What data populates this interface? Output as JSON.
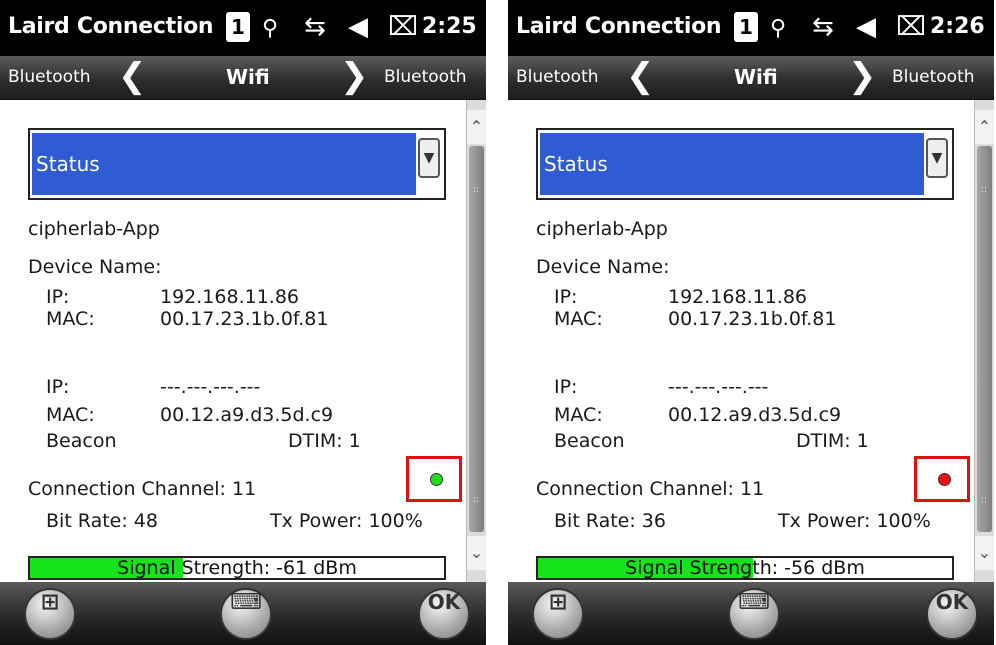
{
  "screens": [
    {
      "app_title": "Laird Connection",
      "sim_label": "1",
      "time": "2:25",
      "nav": {
        "prev_label": "Bluetooth",
        "current": "Wifi",
        "next_label": "Bluetooth",
        "prev_arrow": "❮",
        "next_arrow": "❯"
      },
      "dropdown_selected": "Status",
      "ssid": "cipherlab-App",
      "device_name_label": "Device Name:",
      "ip_label": "IP:",
      "mac_label": "MAC:",
      "ip1": "192.168.11.86",
      "mac1": "00.17.23.1b.0f.81",
      "ip2": "---.---.---.---",
      "mac2": "00.12.a9.d3.5d.c9",
      "beacon_label": "Beacon",
      "dtim": "DTIM: 1",
      "connection_channel": "Connection Channel: 11",
      "bit_rate": "Bit Rate: 48",
      "tx_power": "Tx Power:  100%",
      "indicator_color": "#22dd22",
      "signal_text": "Signal Strength: -61 dBm",
      "signal_fill_fraction": 0.37,
      "ok_label": "OK"
    },
    {
      "app_title": "Laird Connection",
      "sim_label": "1",
      "time": "2:26",
      "nav": {
        "prev_label": "Bluetooth",
        "current": "Wifi",
        "next_label": "Bluetooth",
        "prev_arrow": "❮",
        "next_arrow": "❯"
      },
      "dropdown_selected": "Status",
      "ssid": "cipherlab-App",
      "device_name_label": "Device Name:",
      "ip_label": "IP:",
      "mac_label": "MAC:",
      "ip1": "192.168.11.86",
      "mac1": "00.17.23.1b.0f.81",
      "ip2": "---.---.---.---",
      "mac2": "00.12.a9.d3.5d.c9",
      "beacon_label": "Beacon",
      "dtim": "DTIM: 1",
      "connection_channel": "Connection Channel: 11",
      "bit_rate": "Bit Rate: 36",
      "tx_power": "Tx Power:  100%",
      "indicator_color": "#ee1111",
      "signal_text": "Signal Strength: -56 dBm",
      "signal_fill_fraction": 0.52,
      "ok_label": "OK"
    }
  ],
  "icons": {
    "antenna": "⚲",
    "sync": "⇆",
    "volume": "◀",
    "battery": "⌧",
    "start": "⊞",
    "keyboard": "⌨",
    "dropdown": "▼",
    "scroll_up": "⌃",
    "scroll_down": "⌄"
  },
  "colors": {
    "highlight": "#2f5bd3",
    "signal_fill": "#17e31a",
    "indicator_frame": "#e01010"
  }
}
